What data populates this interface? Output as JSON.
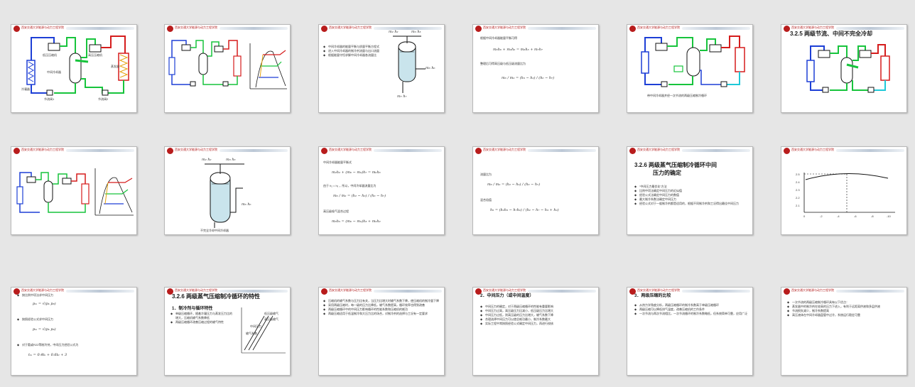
{
  "header_text": "西安交通大学能源与动力工程学院",
  "slides": {
    "s1": {
      "labels": {
        "cond": "冷凝器",
        "evap": "蒸发器",
        "sep": "中间冷却器",
        "comp_low": "低压压缩机",
        "comp_high": "高压压缩机",
        "valve1": "节流阀1",
        "valve2": "节流阀2"
      }
    },
    "s3": {
      "bullets": [
        "中间冷却器的能量平衡与质量平衡方程式",
        "进入中间冷却器的制冷剂流量与出口流量",
        "根据能量守恒求解中间冷却器各流量比"
      ],
      "labels": {
        "m2": "m₂  h₂",
        "m3": "m₃  h₃",
        "m6": "m₆  h₆",
        "m7": "m₇  h₇"
      }
    },
    "s4": {
      "line1": "根据中间冷却器能量平衡可得",
      "eq1": "m₆h₆ + m₂h₂ = m₃h₃ + m₇h₇",
      "line2": "整理后可得高压级与低压级流量比为",
      "eq2": "m₆ / m₂ = (h₃ − h₂) / (h₆ − h₇)"
    },
    "s5": {
      "caption": "带中间冷却器并经一次节流的两级压缩制冷循环"
    },
    "s6": {
      "title": "3.2.5  两级节流、中间不完全冷却"
    },
    "s8": {
      "caption": "不完全冷却中间冷却器"
    },
    "s9": {
      "line1": "中间冷却器能量平衡式",
      "eq1": "m₂h₂ + (m₆ − m₂)h₇ = m₆h₃",
      "line2": "由于 h₂ = h₃ ，所以，中间冷却器流量比为",
      "eq2": "m₆ / m₂ = (h₂ − h₃) / (h₃ − h₇)",
      "line3": "高压级吸气混合过程",
      "eq3": "m₆h₅ = (m₆ − m₂)h₃ + m₂h₂"
    },
    "s10": {
      "line1": "流量比为",
      "eq1": "m₆ / m₂ = (h₂ − h₃) / (h₃ − h₇)",
      "line2": "混合焓值",
      "eq2": "h₅ = (h₂h₃ − h₇h₂) / (h₂ − h₇ − h₃ + h₂)"
    },
    "s11": {
      "title": "3.2.6  两级蒸气压缩制冷循环中间",
      "title2": "压力的确定",
      "bullets": [
        "“中间压力最优化”方法",
        "比例中项法确定中间压力的近似值",
        "经验公式法确定中间压力的数值",
        "最大制冷系数法确定中间压力",
        "经验公式对于一般制冷剂都是适用的，根据不同制冷剂和工况得出最佳中间压力"
      ]
    },
    "s12": {
      "tick_x": [
        "0",
        "-2",
        "-4",
        "-6",
        "-8",
        "-10"
      ],
      "tick_y": [
        "2.5",
        "2.4",
        "2.3",
        "2.2",
        "2.1"
      ]
    },
    "s13": {
      "bullets": [
        "按比例中项法求中间压力",
        "按照经验公式求中间压力",
        "对于氨或R22等制冷剂，中间压力经验公式为"
      ],
      "eq1": "pₘ = √(pₖ p₀)",
      "eq2": "pₘ = √(pₖ p₀)",
      "eq3": "tₘ = 0.4tₖ + 0.6t₀ + 3"
    },
    "s14": {
      "title": "3.2.6  两级蒸气压缩制冷循环的特性",
      "sub": "1．制冷剂与循环特性",
      "bullets": [
        "单级压缩循环，随着冷凝压力与蒸发压力比的增大，压缩机输气系数降低",
        "两级压缩循环改善压缩过程的输气特性"
      ],
      "labels": {
        "a": "低压级输气",
        "b": "高压级输气",
        "c": "中间压力",
        "d": "输气系数"
      }
    },
    "s15": {
      "bullets": [
        "压缩机的输气系数与压力比有关，当压力比增大时输气系数下降，使压缩机的制冷量下降",
        "采用两级压缩时，每一级的压力比降低，输气系数提高，循环效率也得到改善",
        "两级压缩循环中的中间压力影响循环的性能系数和压缩机的耗功",
        "两级压缩适用于低温制冷和大压力比的场合，对制冷剂的选择与工况有一定要求"
      ]
    },
    "s16": {
      "title": "2．中间压力（或中间温度）",
      "bullets": [
        "中间压力的确定，对于两级压缩循环的性能有重要影响",
        "中间压力过高，高压级压力比减小，低压级压力比增大",
        "中间压力过低，则高压级的压力比增大，输气系数下降",
        "合理选择中间压力可以使总耗功最小，制冷系数最大",
        "实际工程中常按照经验公式确定中间压力，再进行校核"
      ]
    },
    "s17": {
      "title": "3．两级压缩的比较",
      "bullets": [
        "从热力学角度分析，两级压缩循环的制冷系数高于单级压缩循环",
        "两级压缩可以降低排气温度，改善压缩机的工作条件",
        "一次节流与两次节流相比，一次节流循环的制冷系数略低，但系统简单可靠，应用广泛"
      ]
    },
    "s18": {
      "bullets": [
        "一次节流的两级压缩制冷循环具有以下优点：",
        "蒸发器中的制冷剂在较高的压力下进入，有利于远距离供液和多层供液",
        "节流损失减少，制冷系数提高",
        "高压液体在中间冷却器盘管中过冷，系统运行稳定可靠"
      ]
    }
  }
}
